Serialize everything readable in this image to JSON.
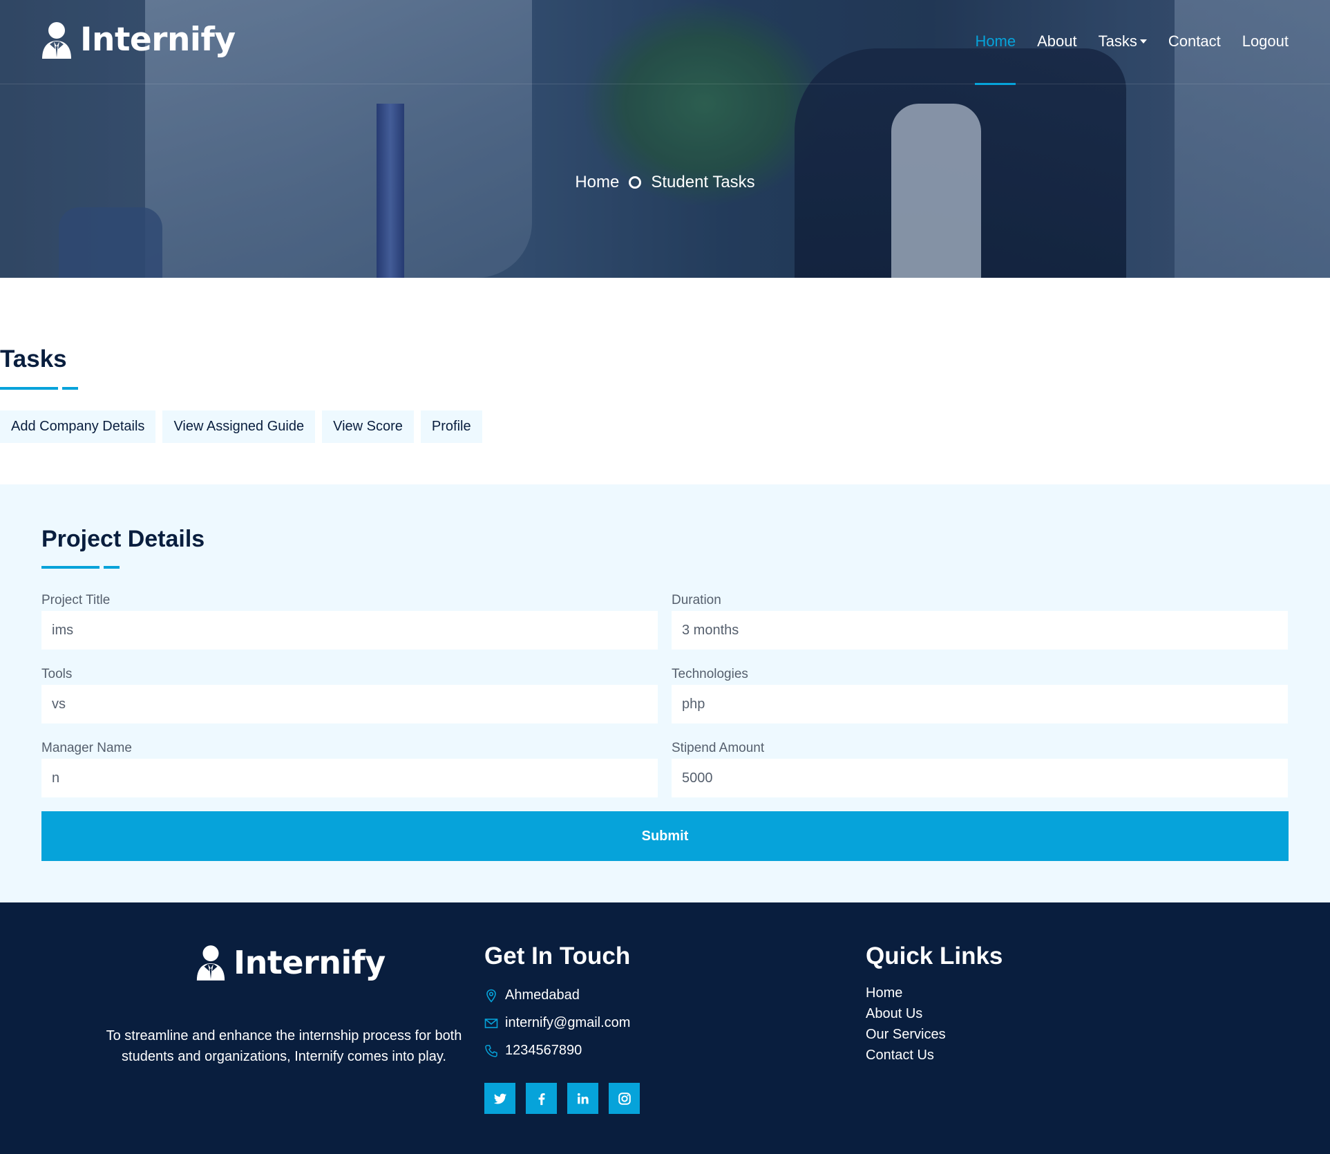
{
  "brand": {
    "name": "Internify"
  },
  "nav": {
    "items": [
      {
        "label": "Home",
        "active": true
      },
      {
        "label": "About",
        "active": false
      },
      {
        "label": "Tasks",
        "active": false,
        "dropdown": true
      },
      {
        "label": "Contact",
        "active": false
      },
      {
        "label": "Logout",
        "active": false
      }
    ]
  },
  "breadcrumb": {
    "home": "Home",
    "current": "Student Tasks"
  },
  "tasks": {
    "title": "Tasks",
    "buttons": [
      "Add Company Details",
      "View Assigned Guide",
      "View Score",
      "Profile"
    ]
  },
  "form": {
    "title": "Project Details",
    "fields": {
      "project_title": {
        "label": "Project Title",
        "value": "ims"
      },
      "duration": {
        "label": "Duration",
        "value": "3 months"
      },
      "tools": {
        "label": "Tools",
        "value": "vs"
      },
      "technologies": {
        "label": "Technologies",
        "value": "php"
      },
      "manager_name": {
        "label": "Manager Name",
        "value": "n"
      },
      "stipend_amount": {
        "label": "Stipend Amount",
        "value": "5000"
      }
    },
    "submit_label": "Submit"
  },
  "footer": {
    "brand": "Internify",
    "description": "To streamline and enhance the internship process for both students and organizations, Internify comes into play.",
    "get_in_touch": {
      "heading": "Get In Touch",
      "address": "Ahmedabad",
      "email": "internify@gmail.com",
      "phone": "1234567890"
    },
    "socials": [
      "twitter-icon",
      "facebook-icon",
      "linkedin-icon",
      "instagram-icon"
    ],
    "quick_links": {
      "heading": "Quick Links",
      "items": [
        "Home",
        "About Us",
        "Our Services",
        "Contact Us"
      ]
    }
  },
  "colors": {
    "accent": "#06a3da",
    "dark": "#091e3e",
    "light_bg": "#eef9ff"
  }
}
